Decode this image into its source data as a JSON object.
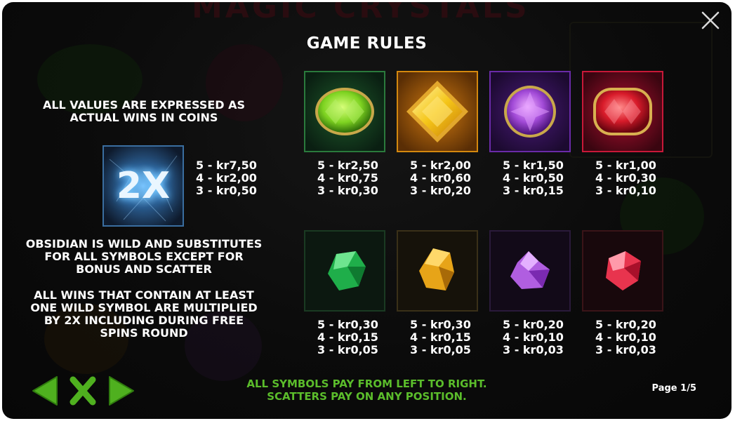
{
  "title": "GAME RULES",
  "intro_text": "ALL VALUES ARE EXPRESSED AS ACTUAL WINS IN COINS",
  "wild": {
    "label": "2X",
    "pays": [
      "5 - kr7,50",
      "4 - kr2,00",
      "3 - kr0,50"
    ]
  },
  "wild_text": "OBSIDIAN IS WILD AND SUBSTITUTES FOR ALL SYMBOLS EXCEPT FOR BONUS AND SCATTER",
  "multiplier_text": "ALL WINS THAT CONTAIN AT LEAST ONE WILD SYMBOL ARE MULTIPLIED BY 2X INCLUDING DURING FREE SPINS ROUND",
  "symbols_row1": [
    {
      "icon": "green-oval-gem-icon",
      "color": "#7ed321",
      "pays": [
        "5 - kr2,50",
        "4 - kr0,75",
        "3 - kr0,30"
      ]
    },
    {
      "icon": "yellow-diamond-gem-icon",
      "color": "#f5c518",
      "pays": [
        "5 - kr2,00",
        "4 - kr0,60",
        "3 - kr0,20"
      ]
    },
    {
      "icon": "purple-round-gem-icon",
      "color": "#a34bd8",
      "pays": [
        "5 - kr1,50",
        "4 - kr0,50",
        "3 - kr0,15"
      ]
    },
    {
      "icon": "red-cushion-gem-icon",
      "color": "#d81b2a",
      "pays": [
        "5 - kr1,00",
        "4 - kr0,30",
        "3 - kr0,10"
      ]
    }
  ],
  "symbols_row2": [
    {
      "icon": "green-crystal-icon",
      "color": "#1fae4a",
      "pays": [
        "5 - kr0,30",
        "4 - kr0,15",
        "3 - kr0,05"
      ]
    },
    {
      "icon": "yellow-crystal-icon",
      "color": "#e7a418",
      "pays": [
        "5 - kr0,30",
        "4 - kr0,15",
        "3 - kr0,05"
      ]
    },
    {
      "icon": "purple-crystal-icon",
      "color": "#b05ee0",
      "pays": [
        "5 - kr0,20",
        "4 - kr0,10",
        "3 - kr0,03"
      ]
    },
    {
      "icon": "red-crystal-icon",
      "color": "#e8344e",
      "pays": [
        "5 - kr0,20",
        "4 - kr0,10",
        "3 - kr0,03"
      ]
    }
  ],
  "footer": {
    "line1": "ALL SYMBOLS PAY FROM LEFT TO RIGHT.",
    "line2": "SCATTERS PAY ON ANY POSITION."
  },
  "page_indicator": "Page 1/5",
  "accent_color": "#5bbd2b"
}
